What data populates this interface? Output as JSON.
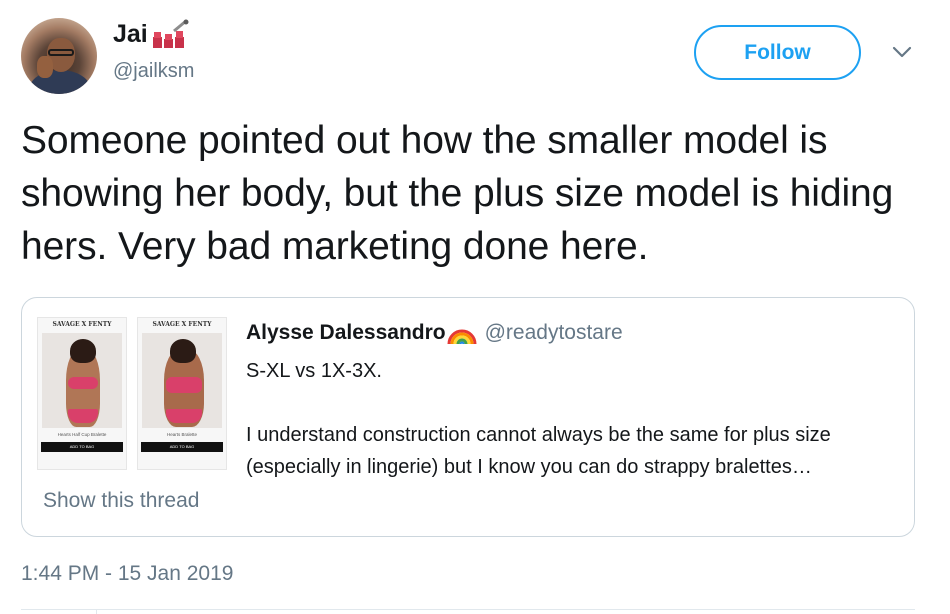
{
  "author": {
    "display_name": "Jai",
    "handle": "@jailksm",
    "avatar_icon": "profile-photo",
    "name_emoji": "lipstick-emoji"
  },
  "follow_button": {
    "label": "Follow",
    "color": "#1da1f2"
  },
  "caret_icon": "chevron-down-icon",
  "tweet": {
    "text": "Someone pointed out how the smaller model is showing her body, but the plus size model is hiding hers. Very bad marketing done here.",
    "timestamp": "1:44 PM - 15 Jan 2019"
  },
  "quoted_tweet": {
    "display_name": "Alysse Dalessandro",
    "name_emoji": "rainbow-emoji",
    "handle": "@readytostare",
    "line1": "S-XL vs 1X-3X.",
    "line2": "I understand construction cannot always be the same for plus size (especially in lingerie) but I know you can do strappy bralettes…",
    "show_thread_label": "Show this thread",
    "media": {
      "left": {
        "brand": "SAVAGE X FENTY",
        "caption": "Hearts Half Cup Bralette",
        "cta": "ADD TO BAG"
      },
      "right": {
        "brand": "SAVAGE X FENTY",
        "caption": "Hearts Bralette",
        "cta": "ADD TO BAG"
      }
    }
  },
  "colors": {
    "text": "#14171a",
    "secondary": "#657786",
    "accent": "#1da1f2",
    "border": "#ccd6dd"
  }
}
